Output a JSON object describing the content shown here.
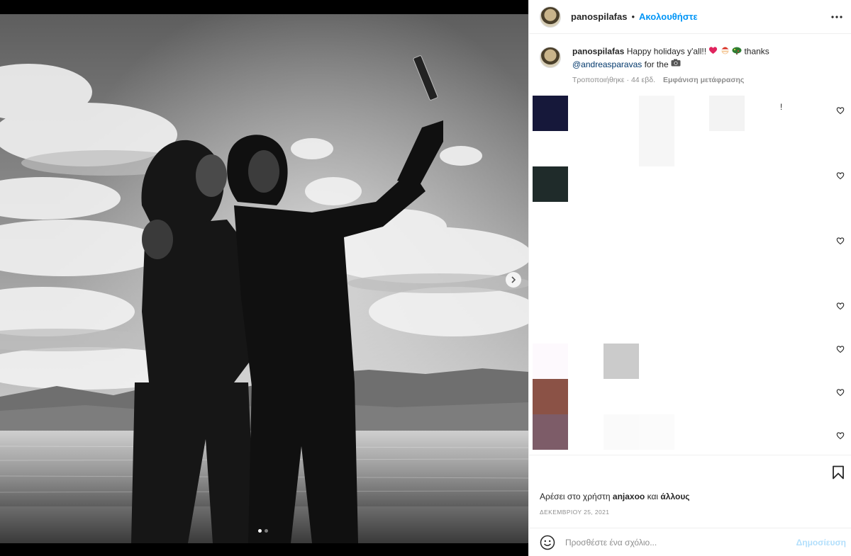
{
  "post": {
    "username": "panospilafas",
    "separator": "•",
    "follow_label": "Ακολουθήστε",
    "caption": {
      "username": "panospilafas",
      "text_before": "Happy holidays y'all!!",
      "emojis": [
        "heart-emoji",
        "santa-emoji",
        "christmas-tree-emoji"
      ],
      "text_after": "thanks",
      "mention": "@andreasparavas",
      "text_end": "for the"
    },
    "edited_label": "Τροποποιήθηκε",
    "time_ago": "44 εβδ.",
    "meta_dot": "·",
    "translate_label": "Εμφάνιση μετάφρασης",
    "comment_exclaim": "!",
    "likes_prefix": "Αρέσει στο χρήστη",
    "likes_user": "anjaxoo",
    "likes_and": "και",
    "likes_others": "άλλους",
    "date": "ΔΕΚΕΜΒΡΙΟΥ 25, 2021",
    "comment_placeholder": "Προσθέστε ένα σχόλιο...",
    "post_label": "Δημοσίευση",
    "carousel": {
      "total": 2,
      "current": 1
    },
    "colors": {
      "accent": "#0095f6",
      "mention": "#00376b",
      "muted": "#8e8e8e",
      "post_disabled": "#b2dffc"
    }
  }
}
